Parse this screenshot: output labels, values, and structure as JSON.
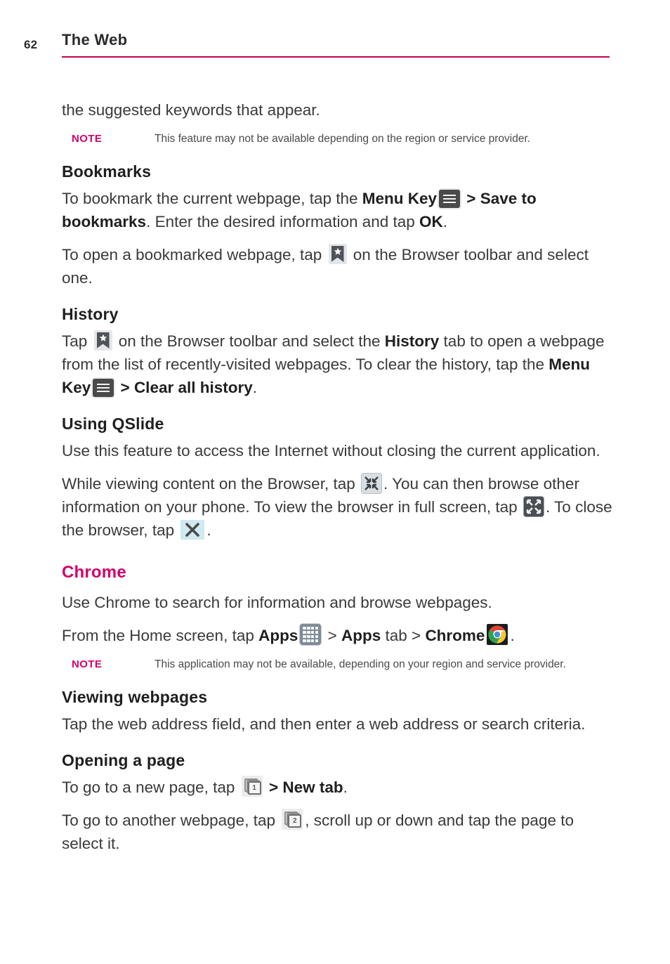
{
  "header": {
    "page_number": "62",
    "title": "The Web",
    "rule_color": "#c2004f"
  },
  "accent_color": "#d3006b",
  "intro": {
    "text": "the suggested keywords that appear."
  },
  "note1": {
    "label": "NOTE",
    "text": "This feature may not be available depending on the region or service provider."
  },
  "bookmarks": {
    "heading": "Bookmarks",
    "para1_a": "To bookmark the current webpage, tap the ",
    "para1_menu_key": "Menu Key",
    "para1_b": " > ",
    "para1_save_to": "Save to bookmarks",
    "para1_c": ". Enter the desired information and tap ",
    "para1_ok": "OK",
    "para1_d": ".",
    "para2_a": "To open a bookmarked webpage, tap ",
    "para2_b": " on the Browser toolbar and select one."
  },
  "history": {
    "heading": "History",
    "para_a": "Tap ",
    "para_b": " on the Browser toolbar and select the ",
    "para_history_tab": "History",
    "para_c": " tab to open a webpage from the list of recently-visited webpages. To clear the history, tap the ",
    "para_menu_key": "Menu Key",
    "para_d": " > ",
    "para_clear_all": "Clear all history",
    "para_e": "."
  },
  "qslide": {
    "heading": "Using QSlide",
    "para1": "Use this feature to access the Internet without closing the current application.",
    "para2_a": "While viewing content on the Browser, tap ",
    "para2_b": ". You can then browse other information on your phone. To view the browser in full screen, tap ",
    "para2_c": ". To close the browser, tap ",
    "para2_d": "."
  },
  "chrome": {
    "heading": "Chrome",
    "para1": "Use Chrome to search for information and browse webpages.",
    "para2_a": "From the Home screen, tap ",
    "para2_apps": "Apps",
    "para2_b": " > ",
    "para2_apps_tab": "Apps",
    "para2_c": " tab > ",
    "para2_chrome": "Chrome",
    "para2_d": "."
  },
  "note2": {
    "label": "NOTE",
    "text": "This application may not be available, depending on your region and service provider."
  },
  "viewing": {
    "heading": "Viewing webpages",
    "para": "Tap the web address field, and then enter a web address or search criteria."
  },
  "opening": {
    "heading": "Opening a page",
    "para1_a": "To go to a new page, tap ",
    "para1_b": " > ",
    "para1_new_tab": "New tab",
    "para1_c": ".",
    "para2_a": "To go to another webpage, tap ",
    "para2_b": ", scroll up or down and tap the page to select it."
  },
  "icons": {
    "menu_key": "menu-key-icon",
    "bookmark_star": "bookmark-star-icon",
    "shrink": "shrink-icon",
    "expand": "expand-fullscreen-icon",
    "close": "close-x-icon",
    "apps_grid": "apps-grid-icon",
    "chrome_logo": "chrome-logo-icon",
    "tab_count_1": "1",
    "tab_count_2": "2"
  }
}
